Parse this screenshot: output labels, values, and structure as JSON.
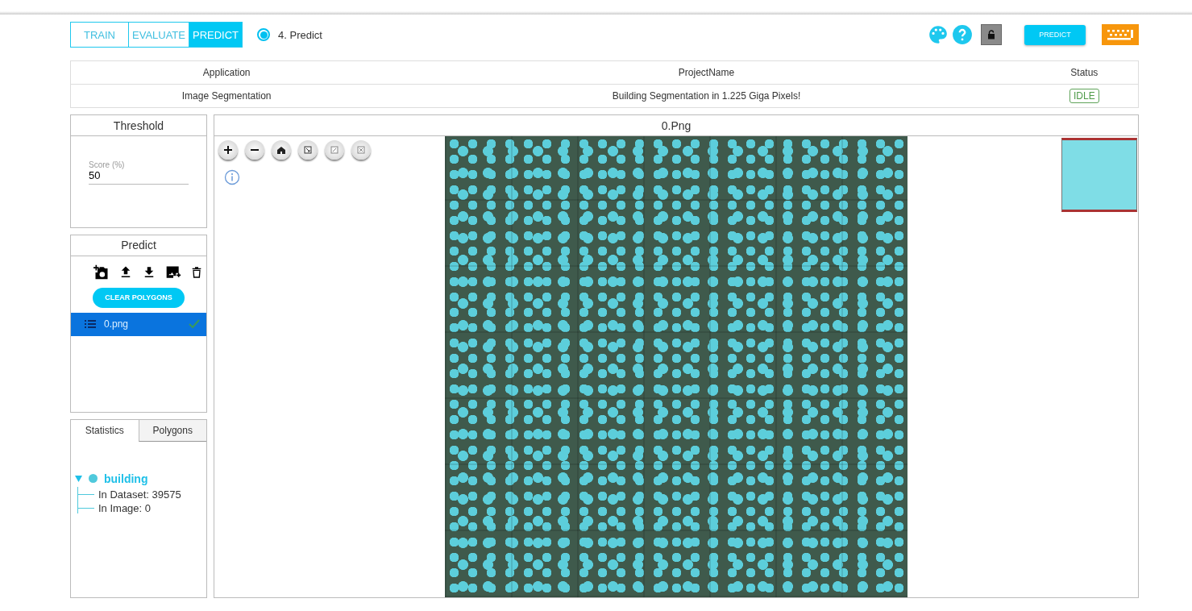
{
  "mode_tabs": [
    {
      "label": "TRAIN",
      "selected": false
    },
    {
      "label": "EVALUATE",
      "selected": false
    },
    {
      "label": "PREDICT",
      "selected": true
    }
  ],
  "step": {
    "label": "4. Predict",
    "selected": true
  },
  "toolbar": {
    "predict_button": "PREDICT"
  },
  "info_table": {
    "columns": [
      "Application",
      "ProjectName",
      "Status"
    ],
    "rows": [
      [
        "Image Segmentation",
        "Building Segmentation in 1.225 Giga Pixels!",
        "IDLE"
      ]
    ]
  },
  "threshold": {
    "title": "Threshold",
    "field": {
      "label": "Score (%)",
      "value": "50"
    }
  },
  "predict_panel": {
    "title": "Predict",
    "clear_button": "CLEAR POLYGONS",
    "files": [
      {
        "name": "0.png",
        "selected": true,
        "done": true
      }
    ]
  },
  "stats_tabs": [
    {
      "label": "Statistics",
      "selected": true
    },
    {
      "label": "Polygons",
      "selected": false
    }
  ],
  "tree": [
    {
      "label": "building",
      "color": "#4fc9dc",
      "expanded": true,
      "children": [
        {
          "label": "In Dataset: 39575"
        },
        {
          "label": "In Image: 0"
        }
      ]
    }
  ],
  "viewer": {
    "title": "0.Png"
  }
}
